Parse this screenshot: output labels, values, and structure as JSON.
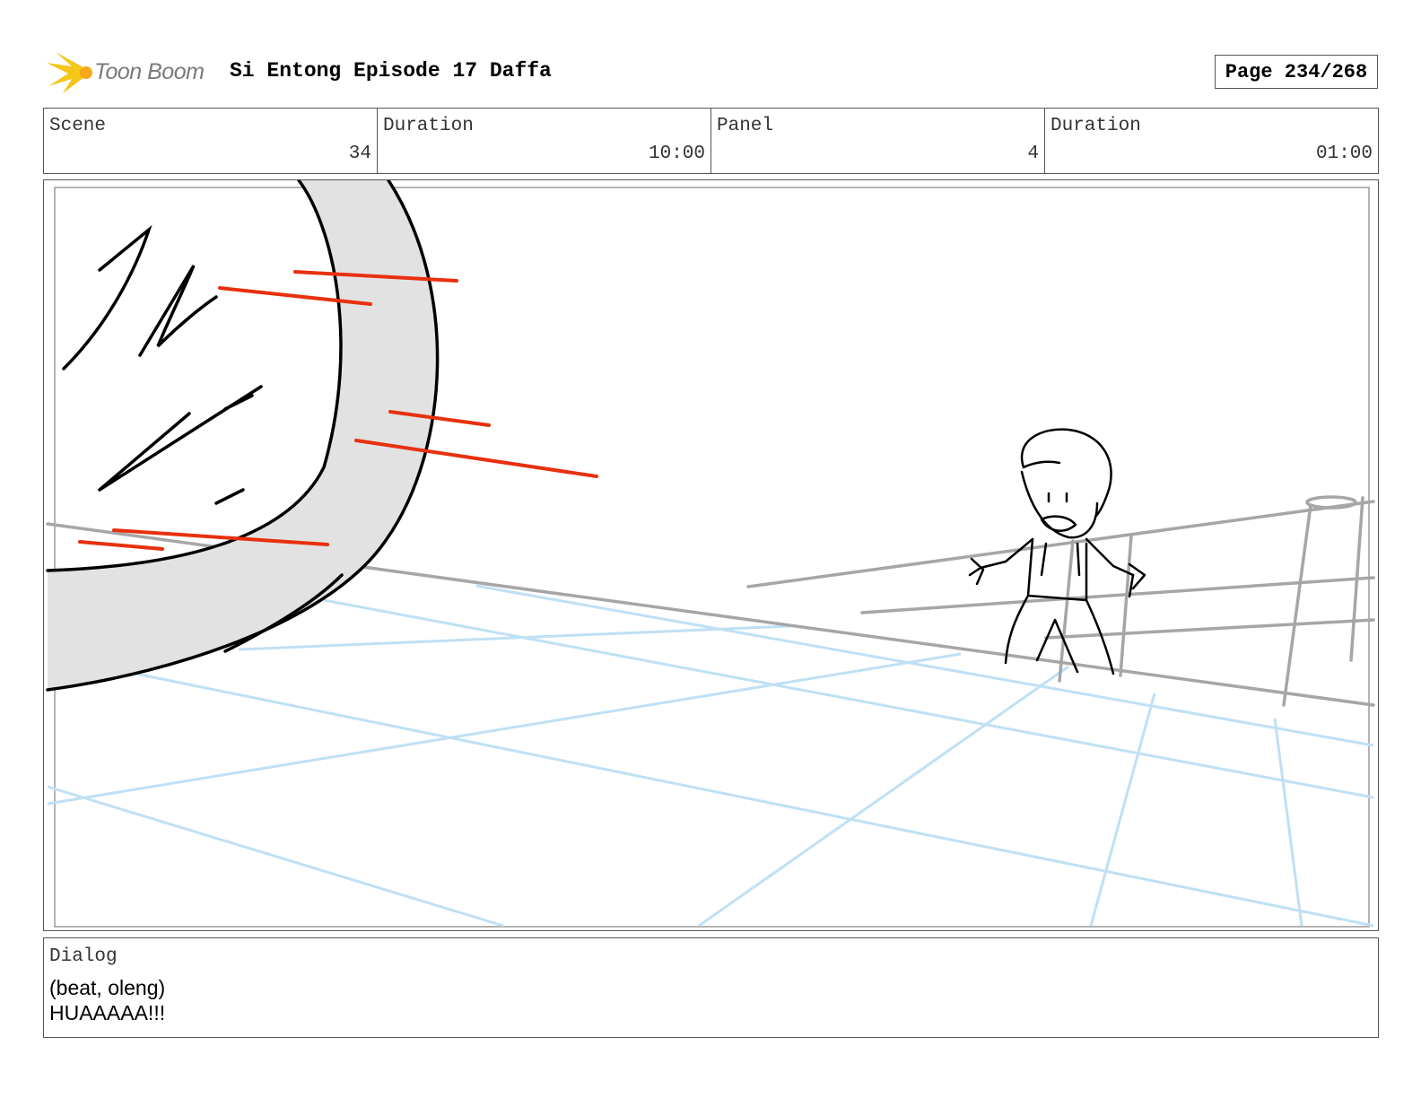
{
  "header": {
    "logo_text": "Toon Boom",
    "project_title": "Si Entong Episode 17 Daffa",
    "page": "Page 234/268"
  },
  "info": {
    "scene_label": "Scene",
    "scene_value": "34",
    "scene_duration_label": "Duration",
    "scene_duration_value": "10:00",
    "panel_label": "Panel",
    "panel_value": "4",
    "panel_duration_label": "Duration",
    "panel_duration_value": "01:00"
  },
  "dialog": {
    "label": "Dialog",
    "lines": [
      "(beat, oleng)",
      "HUAAAAA!!!"
    ]
  },
  "colors": {
    "border": "#555555",
    "sketch_red": "#e8300e",
    "guide_blue": "#bfe0f5",
    "rough_gray": "#a6a6a6",
    "fill_gray": "#e2e2e2",
    "logo_yellow": "#f5c518"
  }
}
